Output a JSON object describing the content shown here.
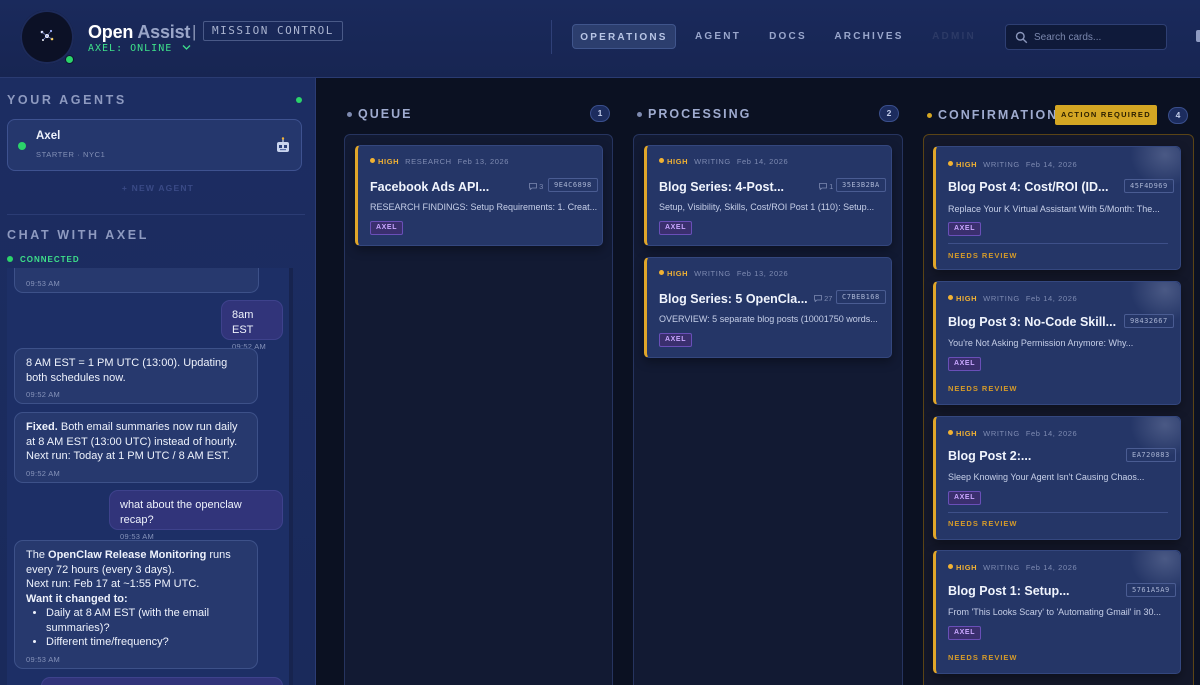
{
  "header": {
    "brand_main": "Open",
    "brand_sub": "Assist",
    "brand_separator": "|",
    "mission_label": "MISSION CONTROL",
    "agent_status": "AXEL: ONLINE",
    "nav": [
      "OPERATIONS",
      "AGENT",
      "DOCS",
      "ARCHIVES",
      "ADMIN"
    ],
    "active_nav": "OPERATIONS",
    "search_placeholder": "Search cards..."
  },
  "sidebar": {
    "agents_title": "YOUR AGENTS",
    "agent": {
      "name": "Axel",
      "subtitle": "STARTER · NYC1"
    },
    "new_agent": "+ NEW AGENT",
    "chat_title": "CHAT WITH AXEL",
    "connection": "CONNECTED",
    "messages": [
      {
        "from": "agent",
        "time": "09:53 AM"
      },
      {
        "from": "user",
        "text": "8am EST",
        "time": "09:52 AM"
      },
      {
        "from": "agent",
        "text": "8 AM EST = 1 PM UTC (13:00). Updating both schedules now.",
        "time": "09:52 AM"
      },
      {
        "from": "agent",
        "bold": "Fixed.",
        "text": " Both email summaries now run daily at 8 AM EST (13:00 UTC) instead of hourly.",
        "text2": "Next run: Today at 1 PM UTC / 8 AM EST.",
        "time": "09:52 AM"
      },
      {
        "from": "user",
        "text": "what about the openclaw recap?",
        "time": "09:53 AM"
      },
      {
        "from": "agent",
        "pre": "The ",
        "bold": "OpenClaw Release Monitoring",
        "text": " runs every 72 hours (every 3 days).",
        "text2": "Next run: Feb 17 at ~1:55 PM UTC.",
        "bold2": "Want it changed to:",
        "bullets": [
          "Daily at 8 AM EST (with the email summaries)?",
          "Different time/frequency?"
        ],
        "time": "09:53 AM"
      }
    ]
  },
  "board": {
    "columns": [
      {
        "name": "QUEUE",
        "count": "1",
        "cards": [
          {
            "priority": "HIGH",
            "category": "RESEARCH",
            "date": "Feb 13, 2026",
            "title": "Facebook Ads API...",
            "comments": "3",
            "hash": "9E4C6898",
            "desc": "RESEARCH FINDINGS: Setup Requirements: 1. Creat...",
            "tag": "AXEL"
          }
        ]
      },
      {
        "name": "PROCESSING",
        "count": "2",
        "cards": [
          {
            "priority": "HIGH",
            "category": "WRITING",
            "date": "Feb 14, 2026",
            "title": "Blog Series: 4-Post...",
            "comments": "1",
            "hash": "35E3B2BA",
            "desc": "Setup, Visibility, Skills, Cost/ROI Post 1 (110): Setup...",
            "tag": "AXEL"
          },
          {
            "priority": "HIGH",
            "category": "WRITING",
            "date": "Feb 13, 2026",
            "title": "Blog Series: 5 OpenCla...",
            "comments": "27",
            "hash": "C7BEB168",
            "desc": "OVERVIEW: 5 separate blog posts (10001750 words...",
            "tag": "AXEL"
          }
        ]
      },
      {
        "name": "CONFIRMATION",
        "count": "4",
        "badge": "ACTION REQUIRED",
        "cards": [
          {
            "priority": "HIGH",
            "category": "WRITING",
            "date": "Feb 14, 2026",
            "title": "Blog Post 4: Cost/ROI (ID...",
            "hash": "45F4D969",
            "desc": "Replace Your K Virtual Assistant With 5/Month: The...",
            "tag": "AXEL",
            "status": "NEEDS REVIEW"
          },
          {
            "priority": "HIGH",
            "category": "WRITING",
            "date": "Feb 14, 2026",
            "title": "Blog Post 3: No-Code Skill...",
            "hash": "98432667",
            "desc": "You're Not Asking Permission Anymore: Why...",
            "tag": "AXEL",
            "status": "NEEDS REVIEW"
          },
          {
            "priority": "HIGH",
            "category": "WRITING",
            "date": "Feb 14, 2026",
            "title": "Blog Post 2:...",
            "hash": "EA720883",
            "desc": "Sleep Knowing Your Agent Isn't Causing Chaos...",
            "tag": "AXEL",
            "status": "NEEDS REVIEW"
          },
          {
            "priority": "HIGH",
            "category": "WRITING",
            "date": "Feb 14, 2026",
            "title": "Blog Post 1: Setup...",
            "hash": "5761A5A9",
            "desc": "From 'This Looks Scary' to 'Automating Gmail' in 30...",
            "tag": "AXEL",
            "status": "NEEDS REVIEW"
          }
        ]
      }
    ]
  },
  "colors": {
    "accent_priority": "#f2b233",
    "online": "#2bd46a",
    "action_required": "#d4a623",
    "tag": "#c9a7ff"
  }
}
